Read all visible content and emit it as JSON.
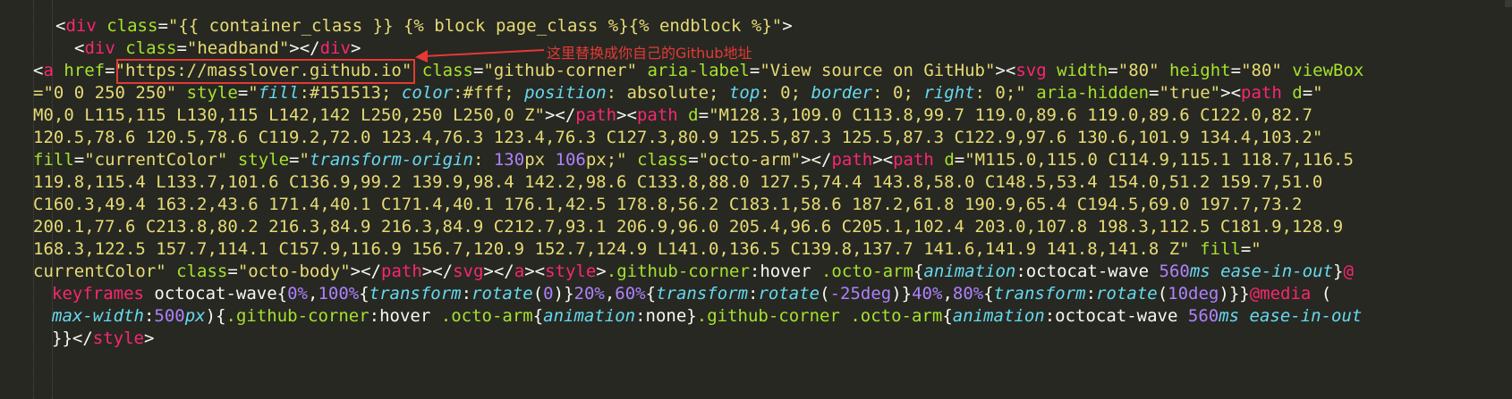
{
  "lines": [
    {
      "indent": 62,
      "tokens": [
        [
          "p",
          "<"
        ],
        [
          "t",
          "div"
        ],
        [
          "p",
          " "
        ],
        [
          "a",
          "class"
        ],
        [
          "p",
          "="
        ],
        [
          "s",
          "\"{{ container_class }} {% block page_class %}{% endblock %}\""
        ],
        [
          "p",
          ">"
        ]
      ]
    },
    {
      "indent": 83,
      "tokens": [
        [
          "p",
          "<"
        ],
        [
          "t",
          "div"
        ],
        [
          "p",
          " "
        ],
        [
          "a",
          "class"
        ],
        [
          "p",
          "="
        ],
        [
          "s",
          "\"headband\""
        ],
        [
          "p",
          "></"
        ],
        [
          "t",
          "div"
        ],
        [
          "p",
          ">"
        ]
      ]
    },
    {
      "indent": 37,
      "tokens": [
        [
          "p",
          "<"
        ],
        [
          "t",
          "a"
        ],
        [
          "p",
          " "
        ],
        [
          "a",
          "href"
        ],
        [
          "p",
          "="
        ],
        [
          "s",
          "\"https://masslover.github.io\""
        ],
        [
          "p",
          " "
        ],
        [
          "a",
          "class"
        ],
        [
          "p",
          "="
        ],
        [
          "s",
          "\"github-corner\""
        ],
        [
          "p",
          " "
        ],
        [
          "a",
          "aria-label"
        ],
        [
          "p",
          "="
        ],
        [
          "s",
          "\"View source on GitHub\""
        ],
        [
          "p",
          "><"
        ],
        [
          "t",
          "svg"
        ],
        [
          "p",
          " "
        ],
        [
          "a",
          "width"
        ],
        [
          "p",
          "="
        ],
        [
          "s",
          "\"80\""
        ],
        [
          "p",
          " "
        ],
        [
          "a",
          "height"
        ],
        [
          "p",
          "="
        ],
        [
          "s",
          "\"80\""
        ],
        [
          "p",
          " "
        ],
        [
          "a",
          "viewBox"
        ]
      ]
    },
    {
      "indent": 37,
      "tokens": [
        [
          "s",
          "=\"0 0 250 250\""
        ],
        [
          "p",
          " "
        ],
        [
          "a",
          "style"
        ],
        [
          "p",
          "="
        ],
        [
          "s",
          "\""
        ],
        [
          "k",
          "fill"
        ],
        [
          "s",
          ":#151513; "
        ],
        [
          "k",
          "color"
        ],
        [
          "s",
          ":#fff; "
        ],
        [
          "k",
          "position"
        ],
        [
          "s",
          ": absolute; "
        ],
        [
          "k",
          "top"
        ],
        [
          "s",
          ": 0; "
        ],
        [
          "k",
          "border"
        ],
        [
          "s",
          ": 0; "
        ],
        [
          "k",
          "right"
        ],
        [
          "s",
          ": 0;\""
        ],
        [
          "p",
          " "
        ],
        [
          "a",
          "aria-hidden"
        ],
        [
          "p",
          "="
        ],
        [
          "s",
          "\"true\""
        ],
        [
          "p",
          "><"
        ],
        [
          "t",
          "path"
        ],
        [
          "p",
          " "
        ],
        [
          "a",
          "d"
        ],
        [
          "p",
          "="
        ],
        [
          "s",
          "\""
        ]
      ]
    },
    {
      "indent": 37,
      "tokens": [
        [
          "s",
          "M0,0 L115,115 L130,115 L142,142 L250,250 L250,0 Z\""
        ],
        [
          "p",
          "></"
        ],
        [
          "t",
          "path"
        ],
        [
          "p",
          "><"
        ],
        [
          "t",
          "path"
        ],
        [
          "p",
          " "
        ],
        [
          "a",
          "d"
        ],
        [
          "p",
          "="
        ],
        [
          "s",
          "\"M128.3,109.0 C113.8,99.7 119.0,89.6 119.0,89.6 C122.0,82.7"
        ]
      ]
    },
    {
      "indent": 37,
      "tokens": [
        [
          "s",
          "120.5,78.6 120.5,78.6 C119.2,72.0 123.4,76.3 123.4,76.3 C127.3,80.9 125.5,87.3 125.5,87.3 C122.9,97.6 130.6,101.9 134.4,103.2\""
        ]
      ]
    },
    {
      "indent": 37,
      "tokens": [
        [
          "a",
          "fill"
        ],
        [
          "p",
          "="
        ],
        [
          "s",
          "\"currentColor\""
        ],
        [
          "p",
          " "
        ],
        [
          "a",
          "style"
        ],
        [
          "p",
          "="
        ],
        [
          "s",
          "\""
        ],
        [
          "k",
          "transform-origin"
        ],
        [
          "s",
          ": "
        ],
        [
          "n",
          "130"
        ],
        [
          "s",
          "px "
        ],
        [
          "n",
          "106"
        ],
        [
          "s",
          "px;\""
        ],
        [
          "p",
          " "
        ],
        [
          "a",
          "class"
        ],
        [
          "p",
          "="
        ],
        [
          "s",
          "\"octo-arm\""
        ],
        [
          "p",
          "></"
        ],
        [
          "t",
          "path"
        ],
        [
          "p",
          "><"
        ],
        [
          "t",
          "path"
        ],
        [
          "p",
          " "
        ],
        [
          "a",
          "d"
        ],
        [
          "p",
          "="
        ],
        [
          "s",
          "\"M115.0,115.0 C114.9,115.1 118.7,116.5"
        ]
      ]
    },
    {
      "indent": 37,
      "tokens": [
        [
          "s",
          "119.8,115.4 L133.7,101.6 C136.9,99.2 139.9,98.4 142.2,98.6 C133.8,88.0 127.5,74.4 143.8,58.0 C148.5,53.4 154.0,51.2 159.7,51.0"
        ]
      ]
    },
    {
      "indent": 37,
      "tokens": [
        [
          "s",
          "C160.3,49.4 163.2,43.6 171.4,40.1 C171.4,40.1 176.1,42.5 178.8,56.2 C183.1,58.6 187.2,61.8 190.9,65.4 C194.5,69.0 197.7,73.2"
        ]
      ]
    },
    {
      "indent": 37,
      "tokens": [
        [
          "s",
          "200.1,77.6 C213.8,80.2 216.3,84.9 216.3,84.9 C212.7,93.1 206.9,96.0 205.4,96.6 C205.1,102.4 203.0,107.8 198.3,112.5 C181.9,128.9"
        ]
      ]
    },
    {
      "indent": 37,
      "tokens": [
        [
          "s",
          "168.3,122.5 157.7,114.1 C157.9,116.9 156.7,120.9 152.7,124.9 L141.0,136.5 C139.8,137.7 141.6,141.9 141.8,141.8 Z\""
        ],
        [
          "p",
          " "
        ],
        [
          "a",
          "fill"
        ],
        [
          "p",
          "="
        ],
        [
          "s",
          "\""
        ]
      ]
    },
    {
      "indent": 37,
      "tokens": [
        [
          "s",
          "currentColor\""
        ],
        [
          "p",
          " "
        ],
        [
          "a",
          "class"
        ],
        [
          "p",
          "="
        ],
        [
          "s",
          "\"octo-body\""
        ],
        [
          "p",
          "></"
        ],
        [
          "t",
          "path"
        ],
        [
          "p",
          "></"
        ],
        [
          "t",
          "svg"
        ],
        [
          "p",
          "></"
        ],
        [
          "t",
          "a"
        ],
        [
          "p",
          "><"
        ],
        [
          "t",
          "style"
        ],
        [
          "p",
          ">"
        ],
        [
          "a",
          ".github-corner"
        ],
        [
          "p",
          ":hover "
        ],
        [
          "a",
          ".octo-arm"
        ],
        [
          "p",
          "{"
        ],
        [
          "k",
          "animation"
        ],
        [
          "p",
          ":octocat-wave "
        ],
        [
          "n",
          "560"
        ],
        [
          "k",
          "ms"
        ],
        [
          "p",
          " "
        ],
        [
          "k",
          "ease-in-out"
        ],
        [
          "p",
          "}"
        ],
        [
          "at",
          "@"
        ]
      ]
    },
    {
      "indent": 58,
      "tokens": [
        [
          "at",
          "keyframes"
        ],
        [
          "p",
          " octocat-wave{"
        ],
        [
          "n",
          "0%"
        ],
        [
          "p",
          ","
        ],
        [
          "n",
          "100%"
        ],
        [
          "p",
          "{"
        ],
        [
          "k",
          "transform"
        ],
        [
          "p",
          ":"
        ],
        [
          "k",
          "rotate"
        ],
        [
          "p",
          "("
        ],
        [
          "n",
          "0"
        ],
        [
          "p",
          ")}"
        ],
        [
          "n",
          "20%"
        ],
        [
          "p",
          ","
        ],
        [
          "n",
          "60%"
        ],
        [
          "p",
          "{"
        ],
        [
          "k",
          "transform"
        ],
        [
          "p",
          ":"
        ],
        [
          "k",
          "rotate"
        ],
        [
          "p",
          "("
        ],
        [
          "n",
          "-25deg"
        ],
        [
          "p",
          ")}"
        ],
        [
          "n",
          "40%"
        ],
        [
          "p",
          ","
        ],
        [
          "n",
          "80%"
        ],
        [
          "p",
          "{"
        ],
        [
          "k",
          "transform"
        ],
        [
          "p",
          ":"
        ],
        [
          "k",
          "rotate"
        ],
        [
          "p",
          "("
        ],
        [
          "n",
          "10deg"
        ],
        [
          "p",
          ")}}"
        ],
        [
          "at",
          "@media"
        ],
        [
          "p",
          " ("
        ]
      ]
    },
    {
      "indent": 58,
      "tokens": [
        [
          "k",
          "max-width"
        ],
        [
          "p",
          ":"
        ],
        [
          "n",
          "500"
        ],
        [
          "k",
          "px"
        ],
        [
          "p",
          "){"
        ],
        [
          "a",
          ".github-corner"
        ],
        [
          "p",
          ":hover "
        ],
        [
          "a",
          ".octo-arm"
        ],
        [
          "p",
          "{"
        ],
        [
          "k",
          "animation"
        ],
        [
          "p",
          ":none}"
        ],
        [
          "a",
          ".github-corner"
        ],
        [
          "p",
          " "
        ],
        [
          "a",
          ".octo-arm"
        ],
        [
          "p",
          "{"
        ],
        [
          "k",
          "animation"
        ],
        [
          "p",
          ":octocat-wave "
        ],
        [
          "n",
          "560"
        ],
        [
          "k",
          "ms"
        ],
        [
          "p",
          " "
        ],
        [
          "k",
          "ease-in-out"
        ]
      ]
    },
    {
      "indent": 58,
      "tokens": [
        [
          "p",
          "}}</"
        ],
        [
          "t",
          "style"
        ],
        [
          "p",
          ">"
        ]
      ]
    }
  ],
  "annotation": {
    "text": "这里替换成你自己的Github地址",
    "highlighted": "\"https://masslover.github.io\""
  },
  "colors": {
    "background": "#272822",
    "tag": "#f92672",
    "attribute": "#a6e22e",
    "string": "#e6db74",
    "keyword": "#66d9ef",
    "number": "#ae81ff",
    "annotation": "#e53935"
  }
}
